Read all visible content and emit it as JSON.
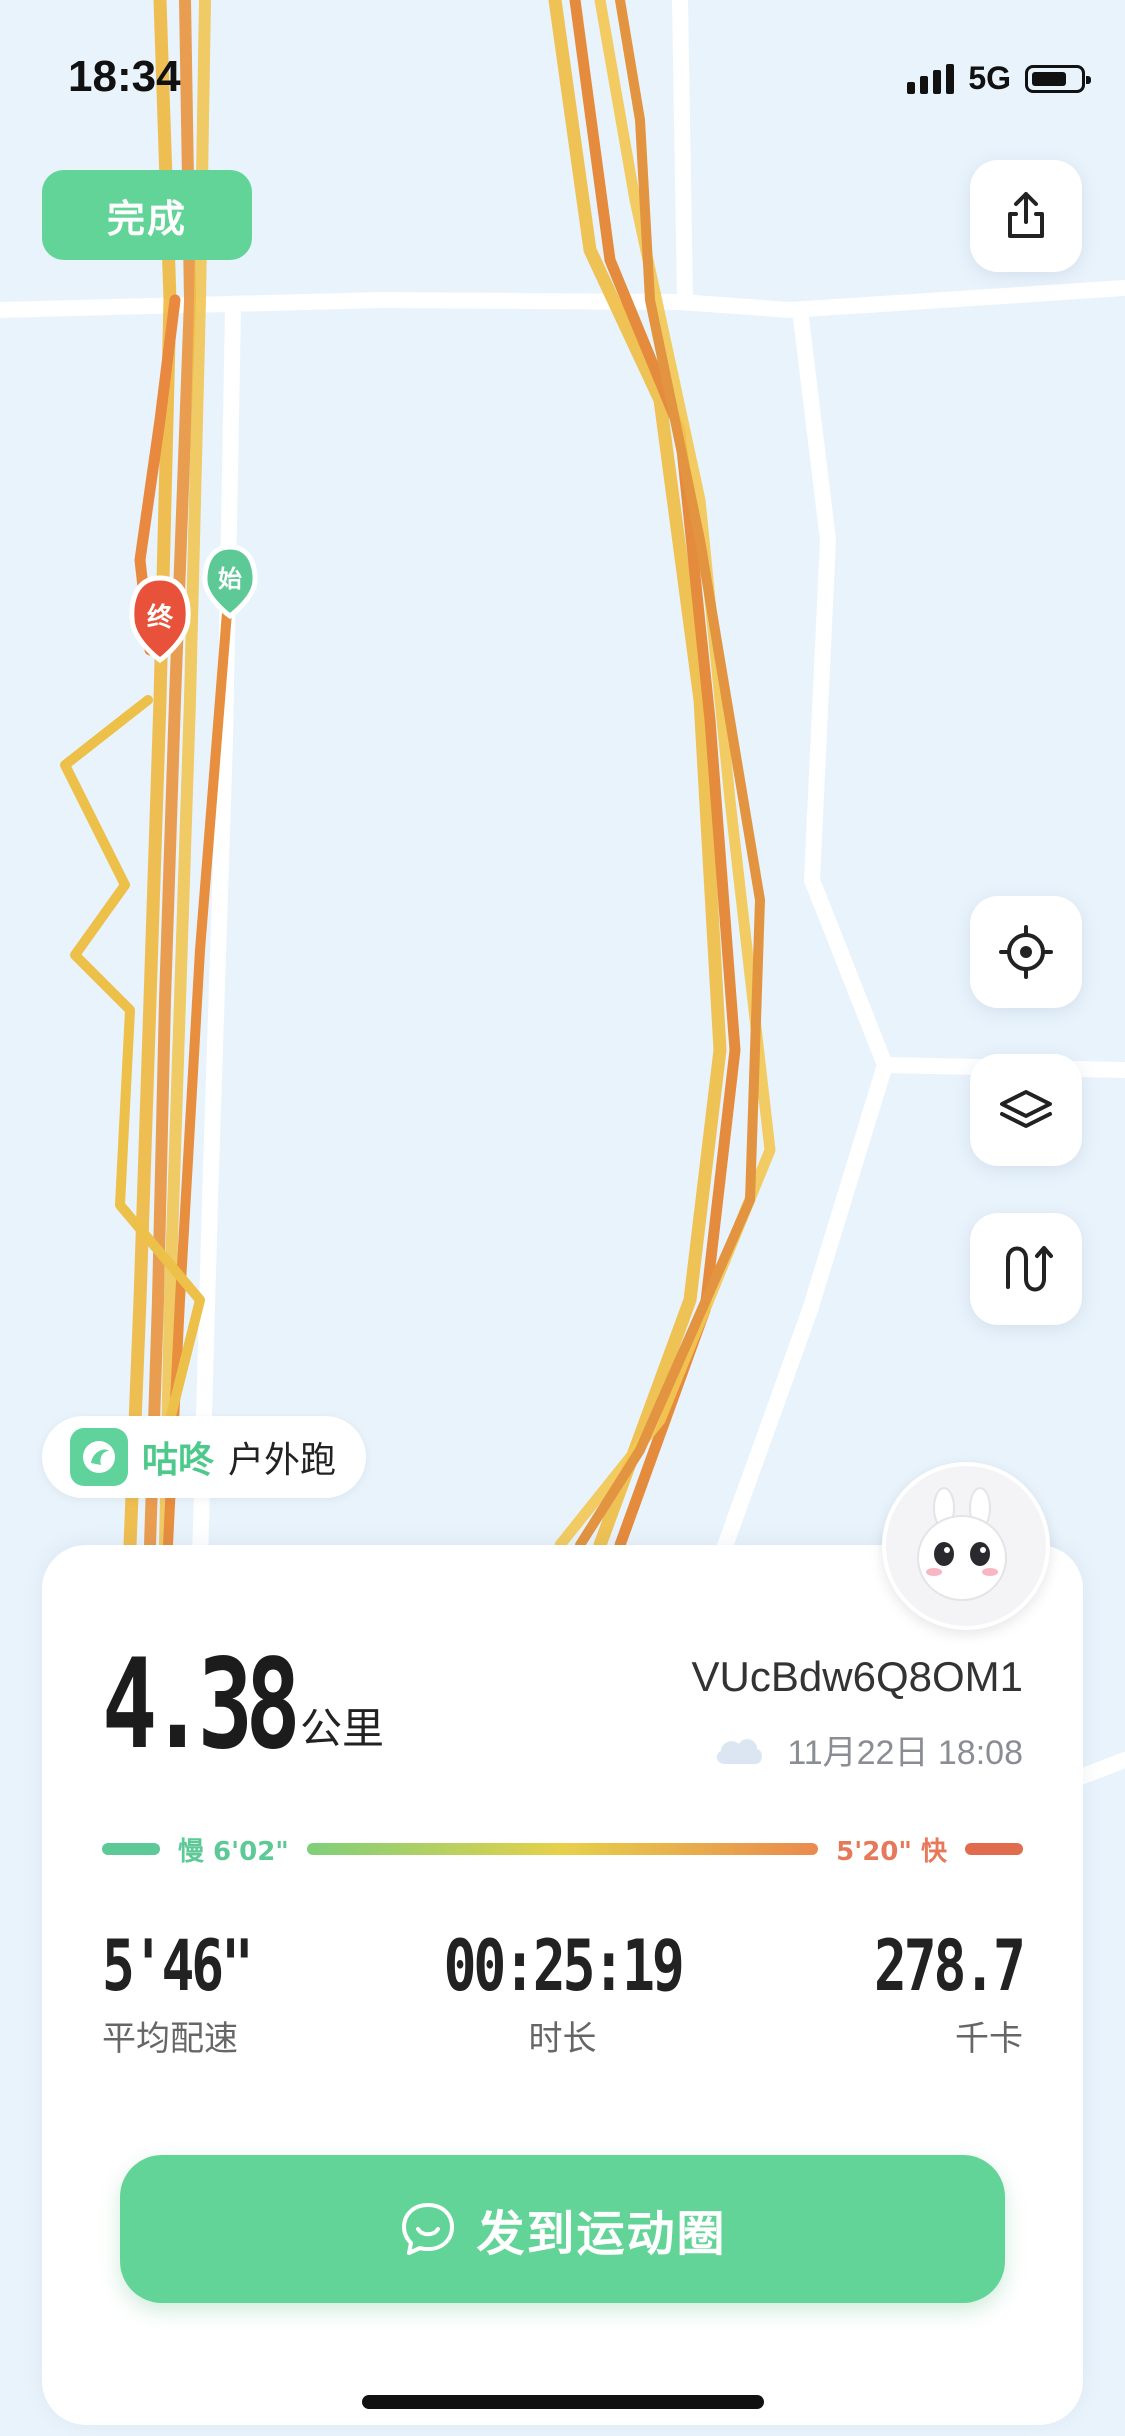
{
  "status_bar": {
    "time": "18:34",
    "network": "5G"
  },
  "top": {
    "done_label": "完成"
  },
  "map": {
    "start_marker": "始",
    "end_marker": "终",
    "controls": [
      "share-icon",
      "locate-icon",
      "layers-icon",
      "route-icon"
    ]
  },
  "brand": {
    "name": "咕咚",
    "activity": "户外跑"
  },
  "summary": {
    "distance": "4.38",
    "distance_unit": "公里",
    "user_id": "VUcBdw6Q8OM1",
    "weather_icon": "cloud-icon",
    "date": "11月22日 18:08",
    "pace_slow_label": "慢 6'02\"",
    "pace_fast_label": "5'20\" 快",
    "colors": {
      "accent": "#63d497",
      "slow": "#5cc996",
      "fast": "#e06b4d"
    }
  },
  "stats": [
    {
      "value": "5'46\"",
      "label": "平均配速"
    },
    {
      "value": "00:25:19",
      "label": "时长"
    },
    {
      "value": "278.7",
      "label": "千卡"
    }
  ],
  "post_button": {
    "label": "发到运动圈"
  }
}
